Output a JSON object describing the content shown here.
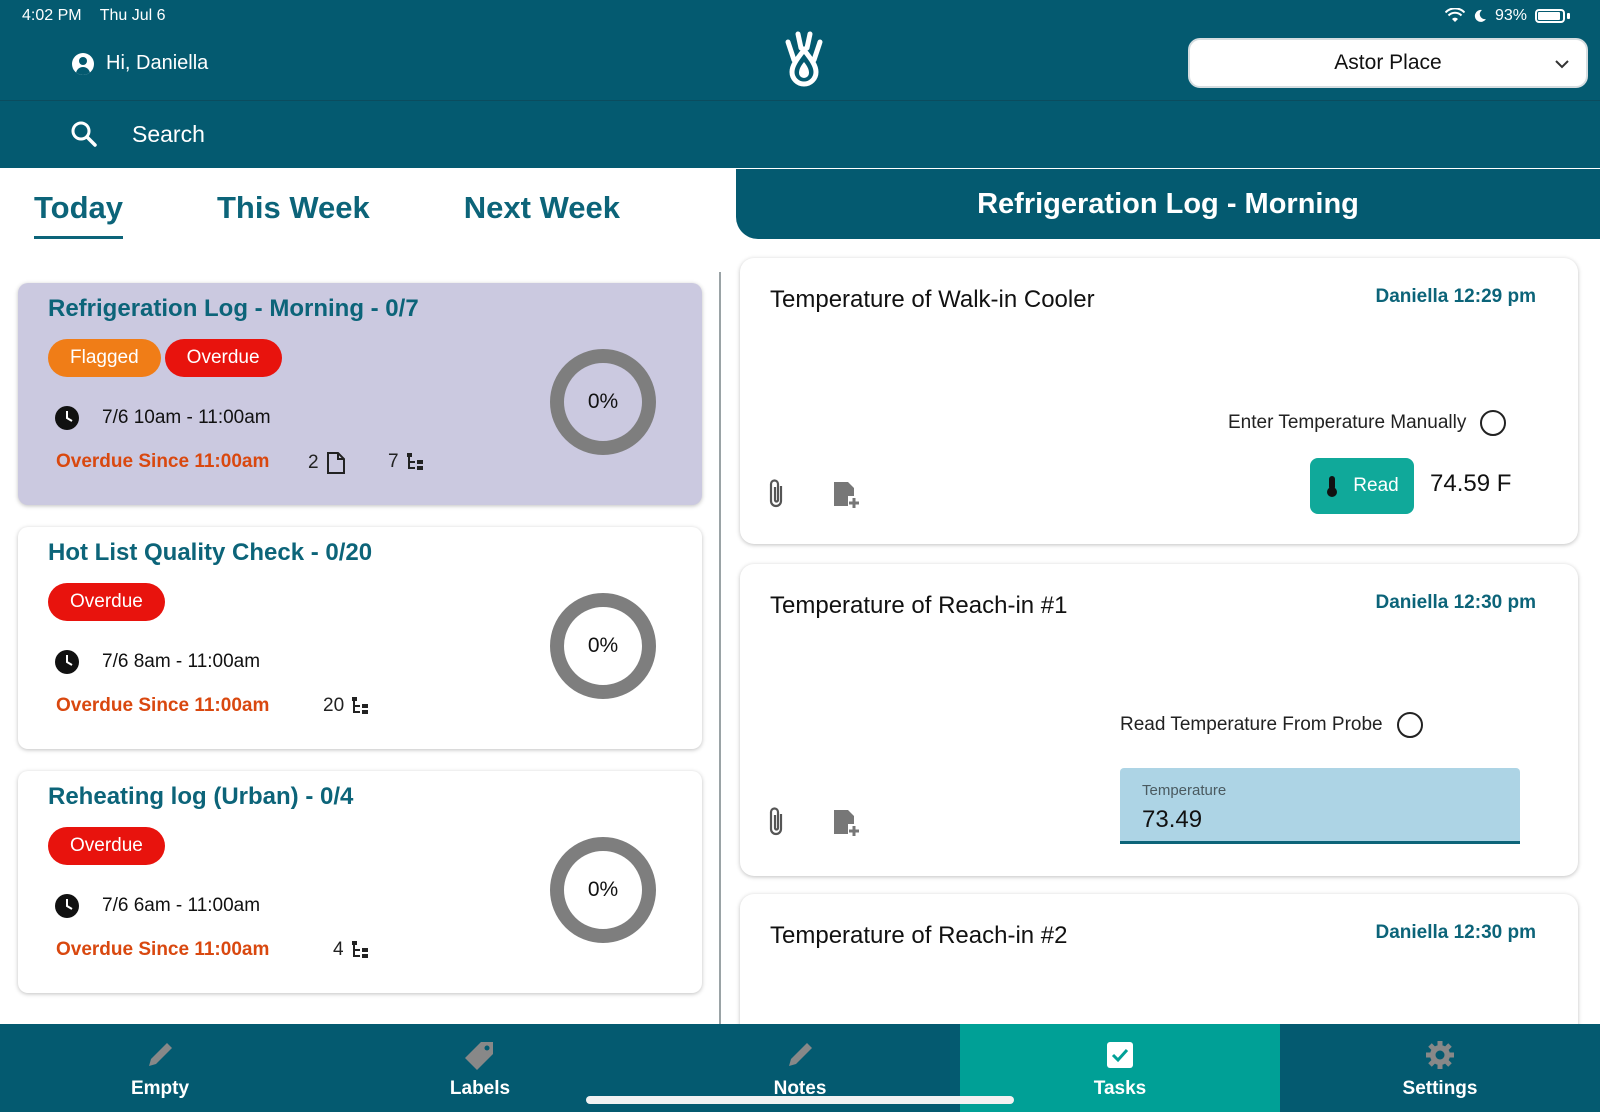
{
  "status_bar": {
    "time": "4:02 PM",
    "date": "Thu Jul 6",
    "battery": "93%"
  },
  "header": {
    "greeting": "Hi, Daniella",
    "location": "Astor Place",
    "search_placeholder": "Search"
  },
  "tabs": [
    {
      "label": "Today",
      "active": true
    },
    {
      "label": "This Week",
      "active": false
    },
    {
      "label": "Next Week",
      "active": false
    }
  ],
  "tasks": [
    {
      "title": "Refrigeration Log - Morning - 0/7",
      "badges": [
        "Flagged",
        "Overdue"
      ],
      "time": "7/6 10am - 11:00am",
      "overdue": "Overdue Since 11:00am",
      "files": "2",
      "subtasks": "7",
      "progress": "0%",
      "progress_value": 0,
      "selected": true
    },
    {
      "title": "Hot List Quality Check - 0/20",
      "badges": [
        "Overdue"
      ],
      "time": "7/6 8am - 11:00am",
      "overdue": "Overdue Since 11:00am",
      "subtasks": "20",
      "progress": "0%",
      "progress_value": 0,
      "selected": false
    },
    {
      "title": "Reheating log (Urban) - 0/4",
      "badges": [
        "Overdue"
      ],
      "time": "7/6 6am - 11:00am",
      "overdue": "Overdue Since 11:00am",
      "subtasks": "4",
      "progress": "0%",
      "progress_value": 0,
      "selected": false
    }
  ],
  "detail": {
    "title": "Refrigeration Log - Morning",
    "items": [
      {
        "title": "Temperature of Walk-in Cooler",
        "meta": "Daniella 12:29 pm",
        "option": "Enter Temperature Manually",
        "read_label": "Read",
        "reading": "74.59 F"
      },
      {
        "title": "Temperature of Reach-in #1",
        "meta": "Daniella 12:30 pm",
        "option": "Read Temperature From Probe",
        "field_label": "Temperature",
        "field_value": "73.49"
      },
      {
        "title": "Temperature of Reach-in #2",
        "meta": "Daniella 12:30 pm"
      }
    ]
  },
  "nav": [
    {
      "label": "Empty",
      "icon": "pencil-icon",
      "active": false
    },
    {
      "label": "Labels",
      "icon": "tag-icon",
      "active": false
    },
    {
      "label": "Notes",
      "icon": "pencil-icon",
      "active": false
    },
    {
      "label": "Tasks",
      "icon": "checkbox-icon",
      "active": true
    },
    {
      "label": "Settings",
      "icon": "gear-icon",
      "active": false
    }
  ],
  "colors": {
    "header": "#045a70",
    "accent": "#0c6479",
    "active_nav": "#00a096",
    "flagged": "#f07d17",
    "overdue": "#e8130d",
    "overdue_text": "#d9480f"
  }
}
